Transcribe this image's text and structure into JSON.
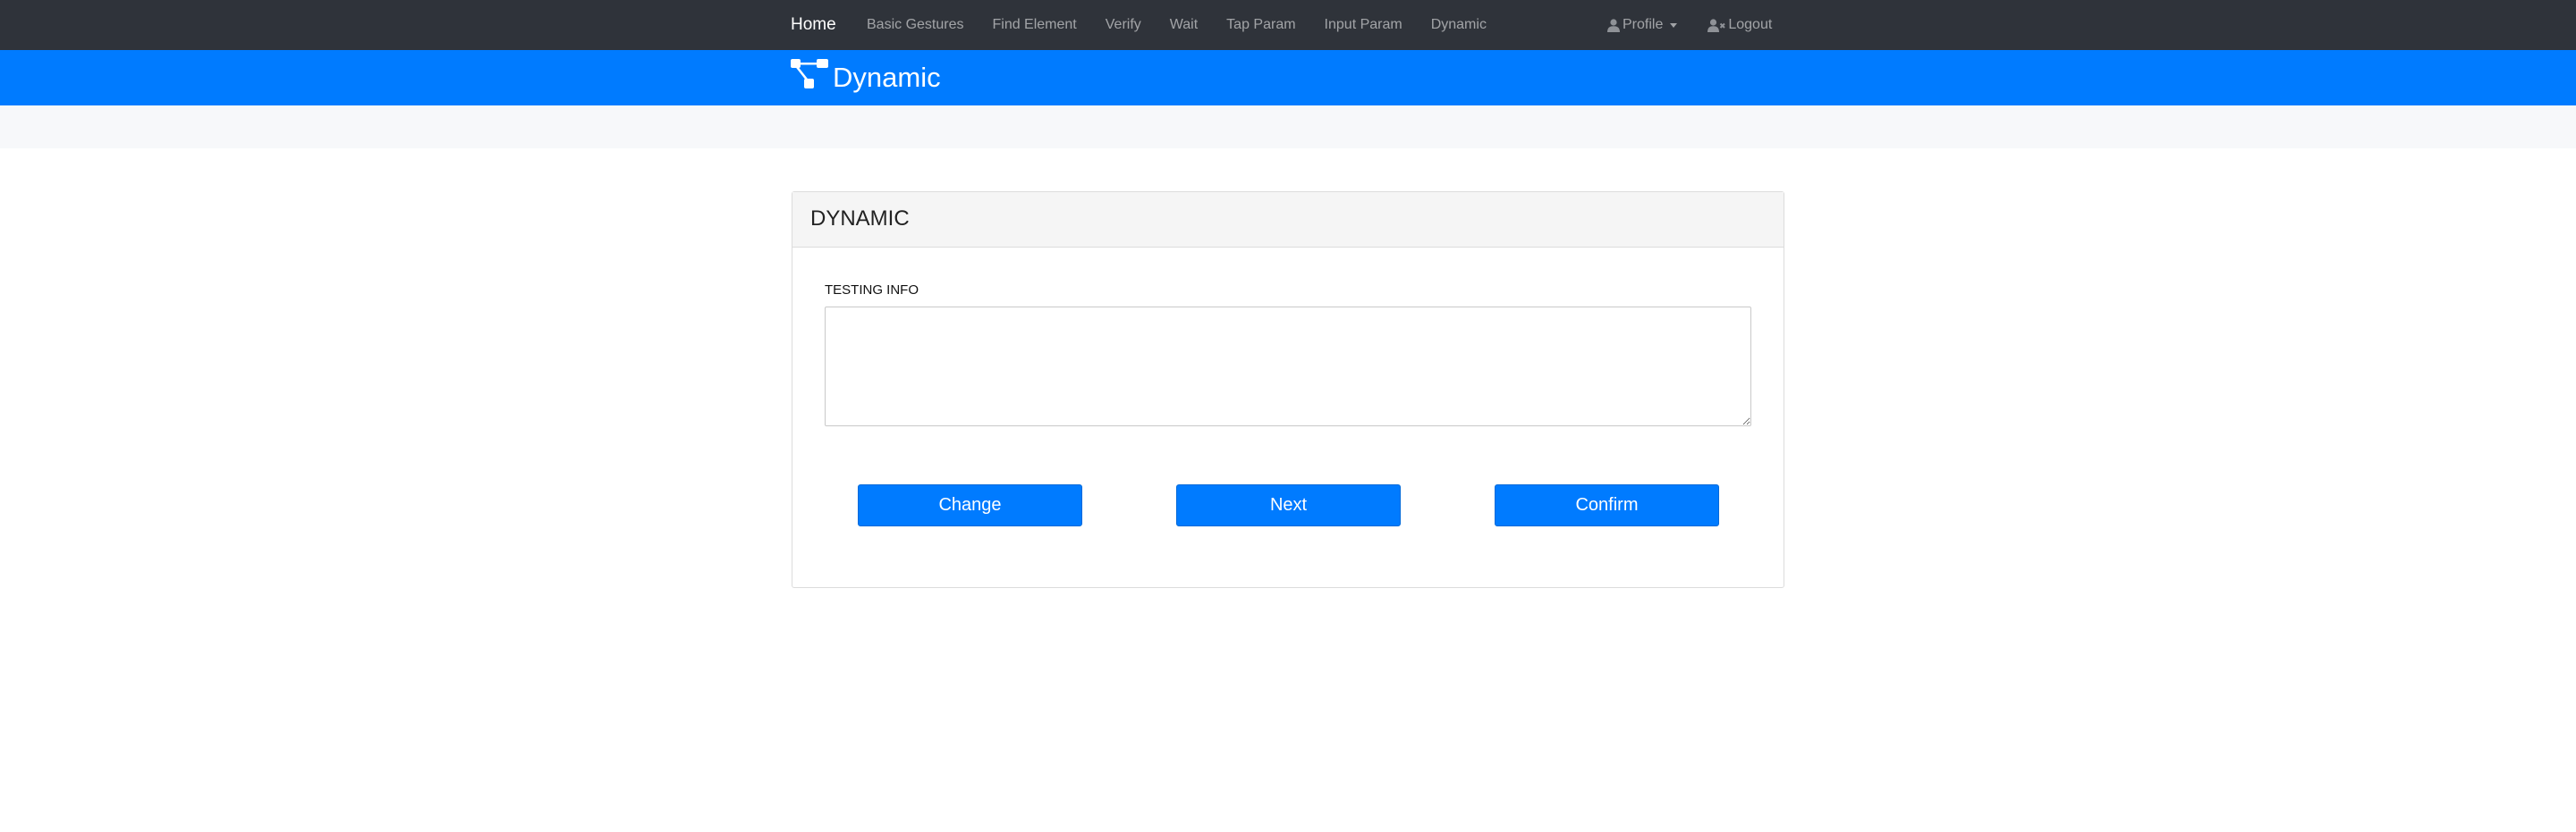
{
  "nav": {
    "brand": "Home",
    "links": [
      "Basic Gestures",
      "Find Element",
      "Verify",
      "Wait",
      "Tap Param",
      "Input Param",
      "Dynamic"
    ],
    "profile_label": "Profile",
    "logout_label": "Logout"
  },
  "header": {
    "title": "Dynamic",
    "icon": "sitemap-icon"
  },
  "card": {
    "title": "DYNAMIC",
    "field_label": "TESTING INFO",
    "textarea_value": "",
    "buttons": {
      "change": "Change",
      "next": "Next",
      "confirm": "Confirm"
    }
  },
  "colors": {
    "navbar_bg": "#2f333a",
    "accent": "#007bff",
    "band_bg": "#f7f8fa",
    "card_header_bg": "#f5f5f5"
  }
}
